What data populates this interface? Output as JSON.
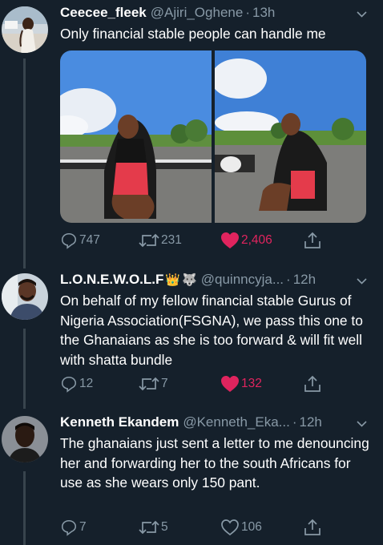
{
  "tweets": [
    {
      "name": "Ceecee_fleek",
      "handle": "@Ajiri_Oghene",
      "time": "13h",
      "text": "Only financial stable people can handle me",
      "replies": "747",
      "retweets": "231",
      "likes": "2,406",
      "liked": true,
      "avatar_icon": "woman-avatar",
      "has_media": true
    },
    {
      "name": "L.O.N.E.W.O.L.F",
      "name_emoji": "👑",
      "name_emoji2": "🐺",
      "handle": "@quinncyja...",
      "time": "12h",
      "text": "On behalf of my fellow financial stable Gurus of Nigeria Association(FSGNA), we pass this one to the Ghanaians as she is too forward & will fit well with shatta bundle",
      "replies": "12",
      "retweets": "7",
      "likes": "132",
      "liked": true,
      "avatar_icon": "man-avatar"
    },
    {
      "name": "Kenneth Ekandem",
      "handle": "@Kenneth_Eka...",
      "time": "12h",
      "text": "The ghanaians just sent a letter to me denouncing her and forwarding her to the south Africans for use as she wears only 150 pant.",
      "replies": "7",
      "retweets": "5",
      "likes": "106",
      "liked": false,
      "avatar_icon": "man-avatar"
    }
  ],
  "colors": {
    "background": "#15202b",
    "secondary_text": "#8899a6",
    "like": "#e0245e",
    "thread_line": "#38444d"
  }
}
